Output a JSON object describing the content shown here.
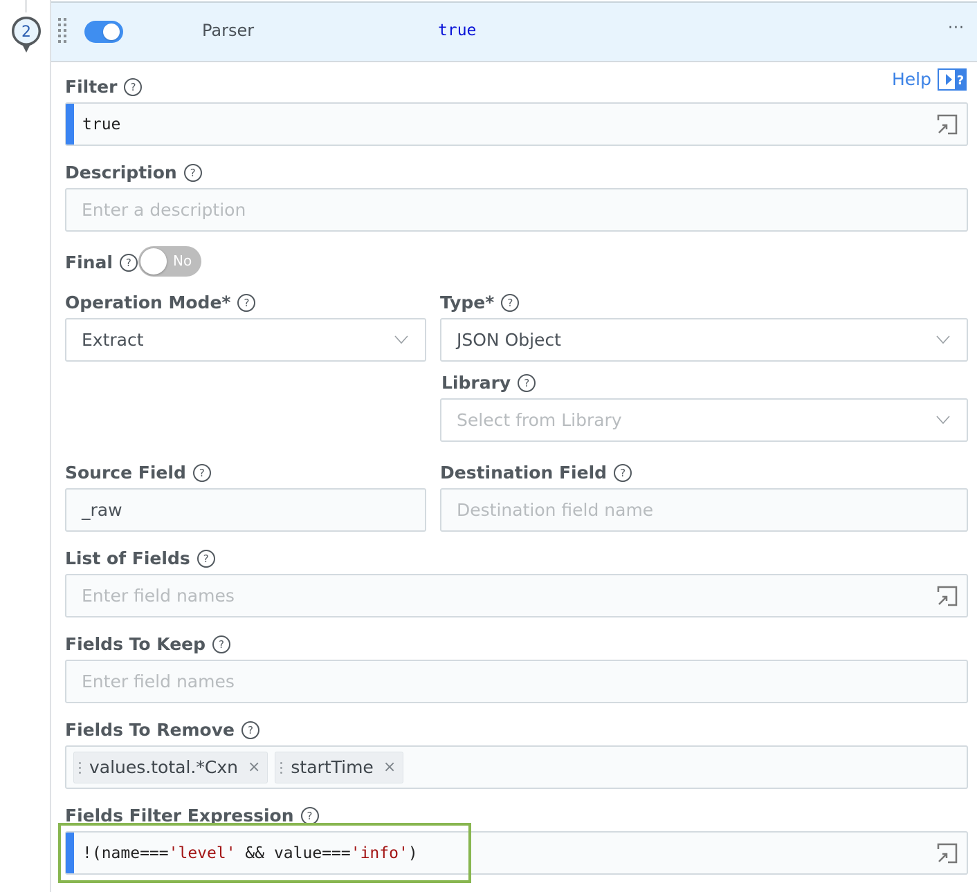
{
  "step": {
    "number": "2",
    "enabled": true,
    "function_name": "Parser",
    "filter_preview": "true",
    "more_menu_label": "···"
  },
  "help": {
    "label": "Help",
    "icon": "help-panel-toggle-icon"
  },
  "form": {
    "filter": {
      "label": "Filter",
      "value": "true"
    },
    "description": {
      "label": "Description",
      "placeholder": "Enter a description",
      "value": ""
    },
    "final": {
      "label": "Final",
      "toggle_text": "No",
      "enabled": false
    },
    "operation_mode": {
      "label": "Operation Mode*",
      "selected": "Extract"
    },
    "type": {
      "label": "Type*",
      "selected": "JSON Object"
    },
    "library": {
      "label": "Library",
      "placeholder": "Select from Library"
    },
    "source_field": {
      "label": "Source Field",
      "value": "_raw"
    },
    "destination_field": {
      "label": "Destination Field",
      "placeholder": "Destination field name"
    },
    "list_of_fields": {
      "label": "List of Fields",
      "placeholder": "Enter field names"
    },
    "fields_to_keep": {
      "label": "Fields To Keep",
      "placeholder": "Enter field names"
    },
    "fields_to_remove": {
      "label": "Fields To Remove",
      "tags": [
        "values.total.*Cxn",
        "startTime"
      ],
      "remove_glyph": "×"
    },
    "fields_filter_expression": {
      "label": "Fields Filter Expression",
      "tokens": {
        "t0": "!(name===",
        "t1": "'level'",
        "t2": " && value===",
        "t3": "'info'",
        "t4": ")"
      }
    }
  },
  "colors": {
    "accent": "#3a84f2",
    "header_bg": "#e8f4fd",
    "keyword": "#0a14d8",
    "string": "#a31515",
    "highlight": "#88b650"
  }
}
